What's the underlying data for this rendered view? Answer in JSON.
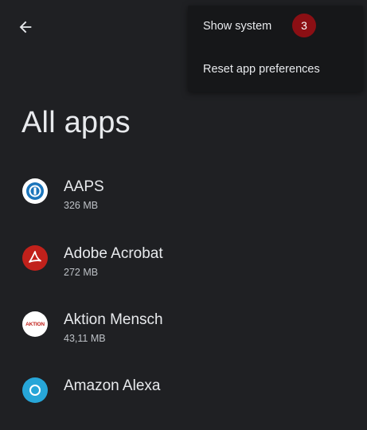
{
  "header": {
    "back_icon": "arrow-back-icon"
  },
  "page": {
    "title": "All apps"
  },
  "apps": [
    {
      "name": "AAPS",
      "size": "326 MB",
      "icon": "aaps-icon"
    },
    {
      "name": "Adobe Acrobat",
      "size": "272 MB",
      "icon": "adobe-acrobat-icon"
    },
    {
      "name": "Aktion Mensch",
      "size": "43,11 MB",
      "icon": "aktion-mensch-icon",
      "icon_text": "AKTION"
    },
    {
      "name": "Amazon Alexa",
      "size": "",
      "icon": "amazon-alexa-icon"
    }
  ],
  "menu": {
    "items": [
      {
        "label": "Show system"
      },
      {
        "label": "Reset app preferences"
      }
    ]
  },
  "badge": {
    "count": "3"
  },
  "colors": {
    "background": "#1f2023",
    "menu_background": "#161719",
    "badge": "#8b0f14",
    "adobe_red": "#c1211b",
    "alexa_blue": "#27a6d8"
  }
}
